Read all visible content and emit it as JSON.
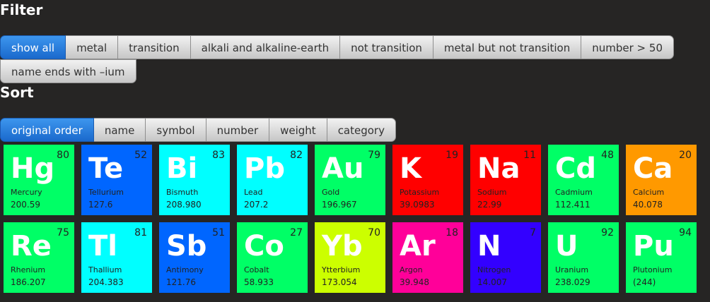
{
  "filter": {
    "heading": "Filter",
    "buttons": [
      "show all",
      "metal",
      "transition",
      "alkali and alkaline-earth",
      "not transition",
      "metal but not transition",
      "number > 50",
      "name ends with –ium"
    ],
    "active": 0
  },
  "sort": {
    "heading": "Sort",
    "buttons": [
      "original order",
      "name",
      "symbol",
      "number",
      "weight",
      "category"
    ],
    "active": 0
  },
  "elements": [
    {
      "symbol": "Hg",
      "number": "80",
      "name": "Mercury",
      "weight": "200.59",
      "color": "#00ff66"
    },
    {
      "symbol": "Te",
      "number": "52",
      "name": "Tellurium",
      "weight": "127.6",
      "color": "#0066ff"
    },
    {
      "symbol": "Bi",
      "number": "83",
      "name": "Bismuth",
      "weight": "208.980",
      "color": "#00ffff"
    },
    {
      "symbol": "Pb",
      "number": "82",
      "name": "Lead",
      "weight": "207.2",
      "color": "#00ffff"
    },
    {
      "symbol": "Au",
      "number": "79",
      "name": "Gold",
      "weight": "196.967",
      "color": "#00ff66"
    },
    {
      "symbol": "K",
      "number": "19",
      "name": "Potassium",
      "weight": "39.0983",
      "color": "#ff0000"
    },
    {
      "symbol": "Na",
      "number": "11",
      "name": "Sodium",
      "weight": "22.99",
      "color": "#ff0000"
    },
    {
      "symbol": "Cd",
      "number": "48",
      "name": "Cadmium",
      "weight": "112.411",
      "color": "#00ff66"
    },
    {
      "symbol": "Ca",
      "number": "20",
      "name": "Calcium",
      "weight": "40.078",
      "color": "#ff9900"
    },
    {
      "symbol": "Re",
      "number": "75",
      "name": "Rhenium",
      "weight": "186.207",
      "color": "#00ff66"
    },
    {
      "symbol": "Tl",
      "number": "81",
      "name": "Thallium",
      "weight": "204.383",
      "color": "#00ffff"
    },
    {
      "symbol": "Sb",
      "number": "51",
      "name": "Antimony",
      "weight": "121.76",
      "color": "#0066ff"
    },
    {
      "symbol": "Co",
      "number": "27",
      "name": "Cobalt",
      "weight": "58.933",
      "color": "#00ff66"
    },
    {
      "symbol": "Yb",
      "number": "70",
      "name": "Ytterbium",
      "weight": "173.054",
      "color": "#ccff00"
    },
    {
      "symbol": "Ar",
      "number": "18",
      "name": "Argon",
      "weight": "39.948",
      "color": "#ff0099"
    },
    {
      "symbol": "N",
      "number": "7",
      "name": "Nitrogen",
      "weight": "14.007",
      "color": "#3300ff"
    },
    {
      "symbol": "U",
      "number": "92",
      "name": "Uranium",
      "weight": "238.029",
      "color": "#00ff66"
    },
    {
      "symbol": "Pu",
      "number": "94",
      "name": "Plutonium",
      "weight": "(244)",
      "color": "#00ff66"
    }
  ]
}
